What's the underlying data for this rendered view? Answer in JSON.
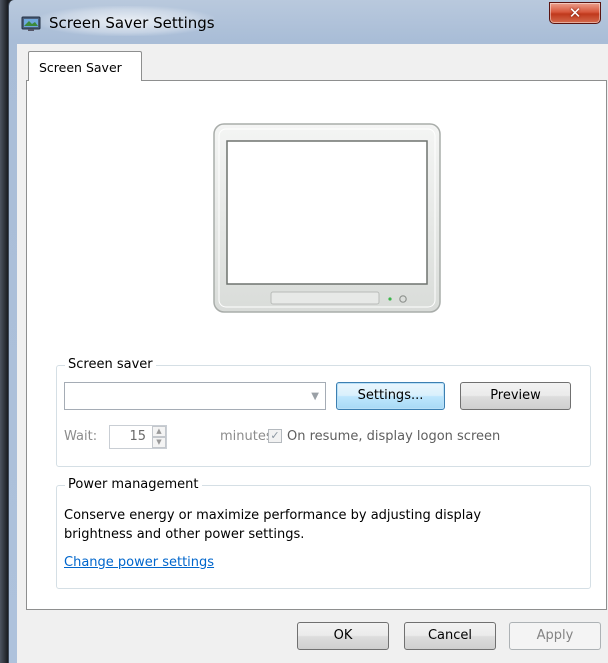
{
  "window": {
    "title": "Screen Saver Settings",
    "close_glyph": "✕"
  },
  "tabs": [
    {
      "label": "Screen Saver",
      "selected": true
    }
  ],
  "screen_saver": {
    "group_label": "Screen saver",
    "selected_value": "",
    "settings_label": "Settings...",
    "preview_label": "Preview",
    "wait_label": "Wait:",
    "wait_value": "15",
    "minutes_label": "minutes",
    "resume_checked": true,
    "resume_label": "On resume, display logon screen"
  },
  "power_management": {
    "group_label": "Power management",
    "description": "Conserve energy or maximize performance by adjusting display brightness and other power settings.",
    "link_label": "Change power settings"
  },
  "buttons": {
    "ok": "OK",
    "cancel": "Cancel",
    "apply": "Apply"
  },
  "icons": {
    "app": "screen-saver-icon",
    "monitor": "monitor-preview-icon",
    "close": "close-icon",
    "dropdown": "chevron-down-icon"
  },
  "colors": {
    "link": "#0066cc",
    "close_button": "#c8452c",
    "focus_button": "#3c7fb1"
  }
}
